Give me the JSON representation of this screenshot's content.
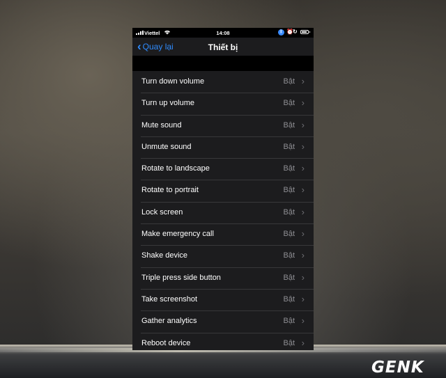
{
  "status_bar": {
    "carrier": "Viettel",
    "time": "14:08",
    "icons": [
      "signal-icon",
      "wifi-icon",
      "bluetooth-icon",
      "alarm-icon",
      "rotation-lock-icon",
      "battery-icon"
    ]
  },
  "nav": {
    "back_label": "Quay lại",
    "title": "Thiết bị"
  },
  "items": [
    {
      "label": "Turn down volume",
      "value": "Bật"
    },
    {
      "label": "Turn up volume",
      "value": "Bật"
    },
    {
      "label": "Mute sound",
      "value": "Bật"
    },
    {
      "label": "Unmute sound",
      "value": "Bật"
    },
    {
      "label": "Rotate to landscape",
      "value": "Bật"
    },
    {
      "label": "Rotate to portrait",
      "value": "Bật"
    },
    {
      "label": "Lock screen",
      "value": "Bật"
    },
    {
      "label": "Make emergency call",
      "value": "Bật"
    },
    {
      "label": "Shake device",
      "value": "Bật"
    },
    {
      "label": "Triple press side button",
      "value": "Bật"
    },
    {
      "label": "Take screenshot",
      "value": "Bật"
    },
    {
      "label": "Gather analytics",
      "value": "Bật"
    },
    {
      "label": "Reboot device",
      "value": "Bật"
    }
  ],
  "watermark": "GENK",
  "colors": {
    "accent": "#2f8cff",
    "cell_bg": "#1c1c1e",
    "secondary_text": "#8e8e93"
  }
}
